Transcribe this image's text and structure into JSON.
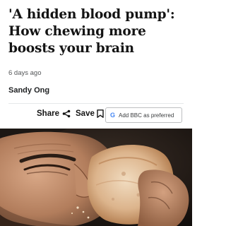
{
  "article": {
    "headline": "'A hidden blood pump': How chewing more boosts your brain",
    "timestamp": "6 days ago",
    "author": "Sandy Ong"
  },
  "actions": {
    "share_label": "Share",
    "save_label": "Save",
    "preferred_label": "Add BBC as preferred",
    "google_letter": "G"
  },
  "hero": {
    "subject": "man-biting-bread"
  },
  "colors": {
    "text": "#141414",
    "muted": "#545658",
    "border": "#bdbfc1",
    "google_blue": "#4285F4"
  }
}
